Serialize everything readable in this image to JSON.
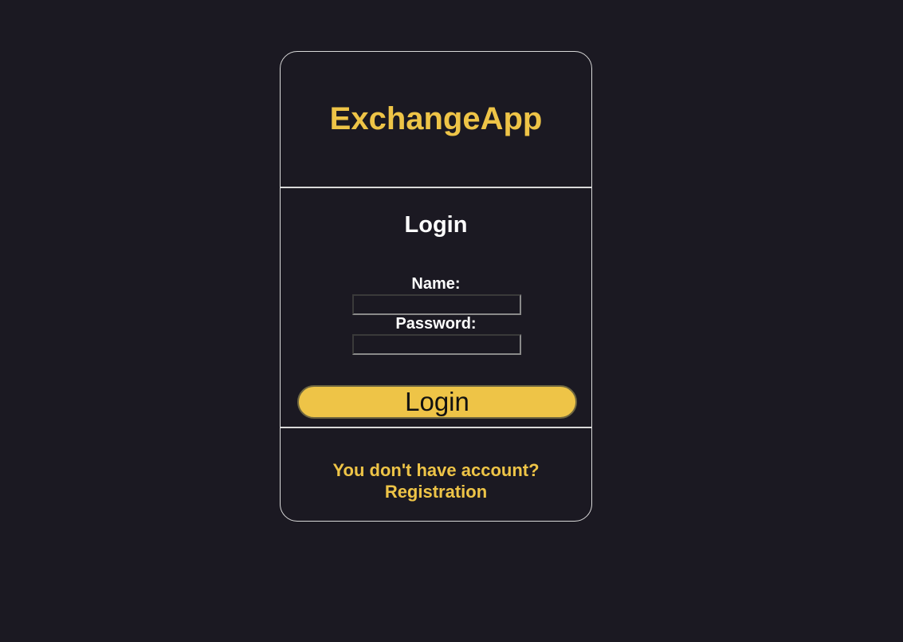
{
  "app": {
    "title": "ExchangeApp"
  },
  "login_form": {
    "heading": "Login",
    "name_label": "Name:",
    "name_value": "",
    "password_label": "Password:",
    "password_value": "",
    "submit_label": "Login"
  },
  "footer": {
    "question": "You don't have account?",
    "registration_link": "Registration"
  },
  "colors": {
    "background": "#1b1922",
    "accent": "#eec447",
    "text": "#ffffff",
    "border": "#d9d9d9"
  }
}
